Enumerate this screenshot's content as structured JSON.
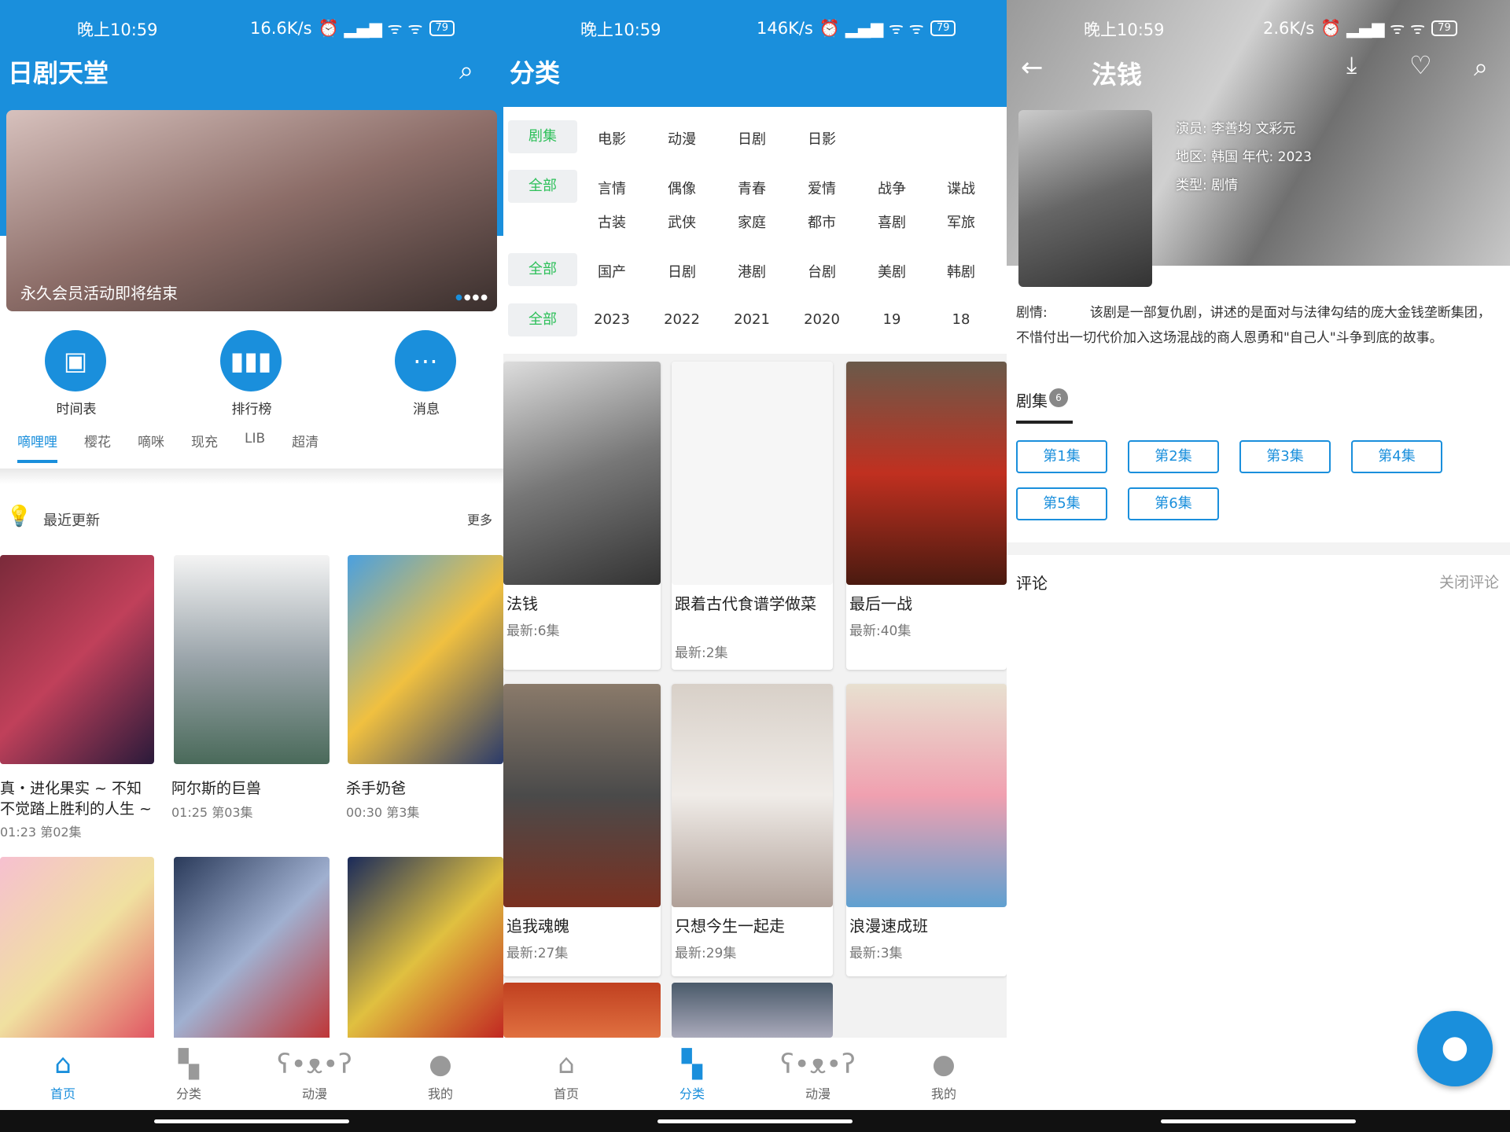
{
  "status": [
    {
      "time": "晚上10:59",
      "speed": "16.6K/s",
      "battery": "79"
    },
    {
      "time": "晚上10:59",
      "speed": "146K/s",
      "battery": "79"
    },
    {
      "time": "晚上10:59",
      "speed": "2.6K/s",
      "battery": "79"
    }
  ],
  "home": {
    "title": "日剧天堂",
    "banner_caption": "永久会员活动即将结束",
    "shortcuts": [
      {
        "label": "时间表",
        "icon": "calendar-icon"
      },
      {
        "label": "排行榜",
        "icon": "chart-icon"
      },
      {
        "label": "消息",
        "icon": "message-icon"
      }
    ],
    "tabs": [
      "嘀哩哩",
      "樱花",
      "嘀咪",
      "现充",
      "LIB",
      "超清"
    ],
    "section": {
      "title": "最近更新",
      "more": "更多"
    },
    "items": [
      {
        "title": "真・进化果实 ~ 不知不觉踏上胜利的人生 ~",
        "sub": "01:23 第02集"
      },
      {
        "title": "阿尔斯的巨兽",
        "sub": "01:25 第03集"
      },
      {
        "title": "杀手奶爸",
        "sub": "00:30 第3集"
      }
    ]
  },
  "category": {
    "title": "分类",
    "rows": [
      [
        "剧集",
        "电影",
        "动漫",
        "日剧",
        "日影"
      ],
      [
        "全部",
        "言情",
        "偶像",
        "青春",
        "爱情",
        "战争",
        "谍战",
        "古装",
        "武侠",
        "家庭",
        "都市",
        "喜剧",
        "军旅"
      ],
      [
        "全部",
        "国产",
        "日剧",
        "港剧",
        "台剧",
        "美剧",
        "韩剧"
      ],
      [
        "全部",
        "2023",
        "2022",
        "2021",
        "2020",
        "19",
        "18"
      ]
    ],
    "items": [
      {
        "title": "法钱",
        "sub": "最新:6集"
      },
      {
        "title": "跟着古代食谱学做菜",
        "sub": "最新:2集"
      },
      {
        "title": "最后一战",
        "sub": "最新:40集"
      },
      {
        "title": "追我魂魄",
        "sub": "最新:27集"
      },
      {
        "title": "只想今生一起走",
        "sub": "最新:29集"
      },
      {
        "title": "浪漫速成班",
        "sub": "最新:3集"
      }
    ]
  },
  "detail": {
    "title": "法钱",
    "actors": "演员: 李善均 文彩元",
    "region": "地区: 韩国 年代: 2023",
    "genre": "类型: 剧情",
    "synopsis_label": "剧情:",
    "synopsis": "该剧是一部复仇剧，讲述的是面对与法律勾结的庞大金钱垄断集团，不惜付出一切代价加入这场混战的商人恩勇和\"自己人\"斗争到底的故事。",
    "episodes_tab": "剧集",
    "episode_count": "6",
    "episodes": [
      "第1集",
      "第2集",
      "第3集",
      "第4集",
      "第5集",
      "第6集"
    ],
    "comments": "评论",
    "close_comments": "关闭评论"
  },
  "nav": [
    [
      "首页",
      "分类",
      "动漫",
      "我的"
    ]
  ],
  "nav_labels": {
    "home": "首页",
    "category": "分类",
    "anime": "动漫",
    "mine": "我的"
  },
  "colors": {
    "accent": "#1a8fdc",
    "selected_chip": "#2ec05a"
  }
}
